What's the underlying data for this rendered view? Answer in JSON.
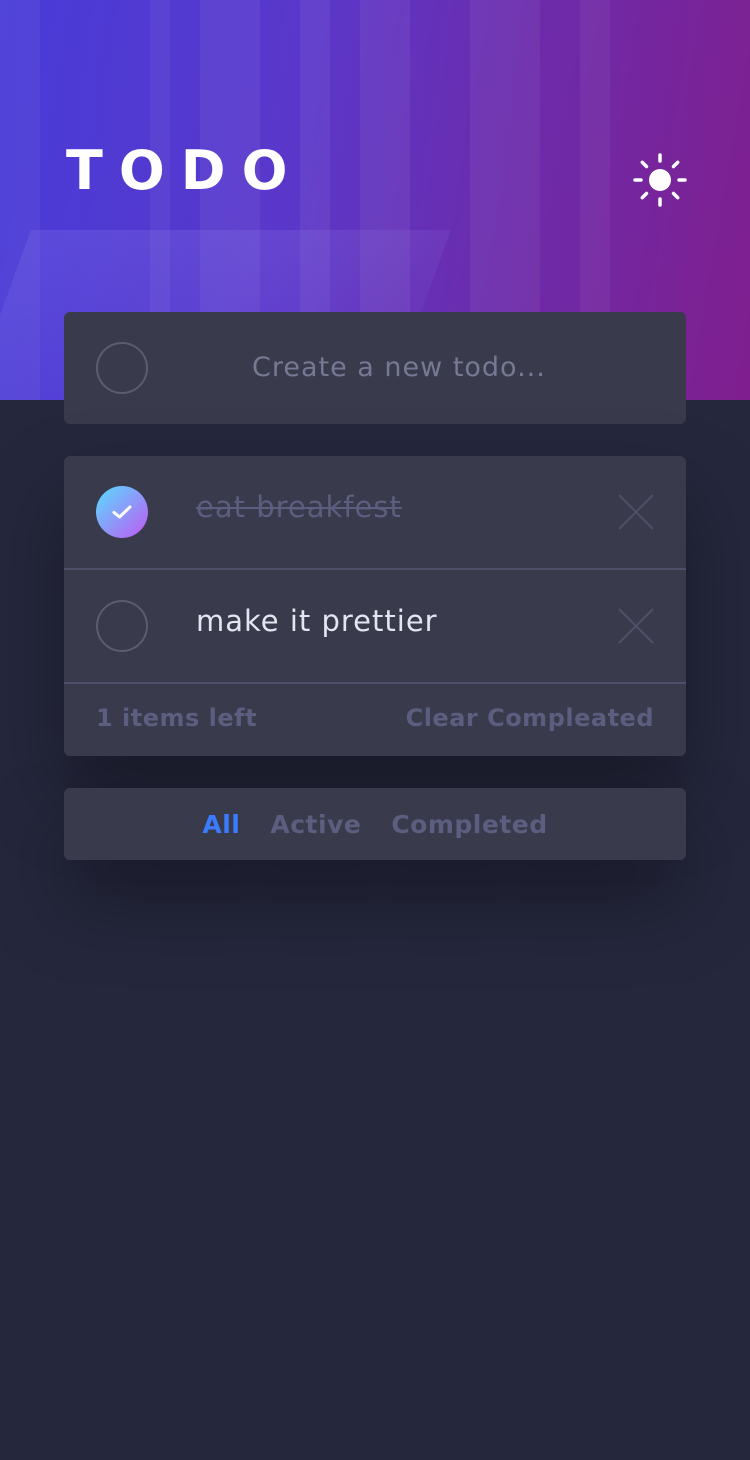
{
  "app": {
    "title": "TODO"
  },
  "header": {
    "theme_toggle_icon": "sun-icon"
  },
  "new_todo": {
    "placeholder": "Create a new todo..."
  },
  "todos": [
    {
      "text": "eat breakfest",
      "completed": true
    },
    {
      "text": "make it prettier",
      "completed": false
    }
  ],
  "footer": {
    "items_left": "1 items left",
    "clear_label": "Clear Compleated"
  },
  "filters": {
    "all": "All",
    "active": "Active",
    "completed": "Completed",
    "selected": "All"
  },
  "colors": {
    "background": "#25273d",
    "card": "#393a4c",
    "accent": "#3a7cfd",
    "check_gradient_start": "#57ddff",
    "check_gradient_end": "#c058f3",
    "muted_text": "#5b5e7e"
  }
}
